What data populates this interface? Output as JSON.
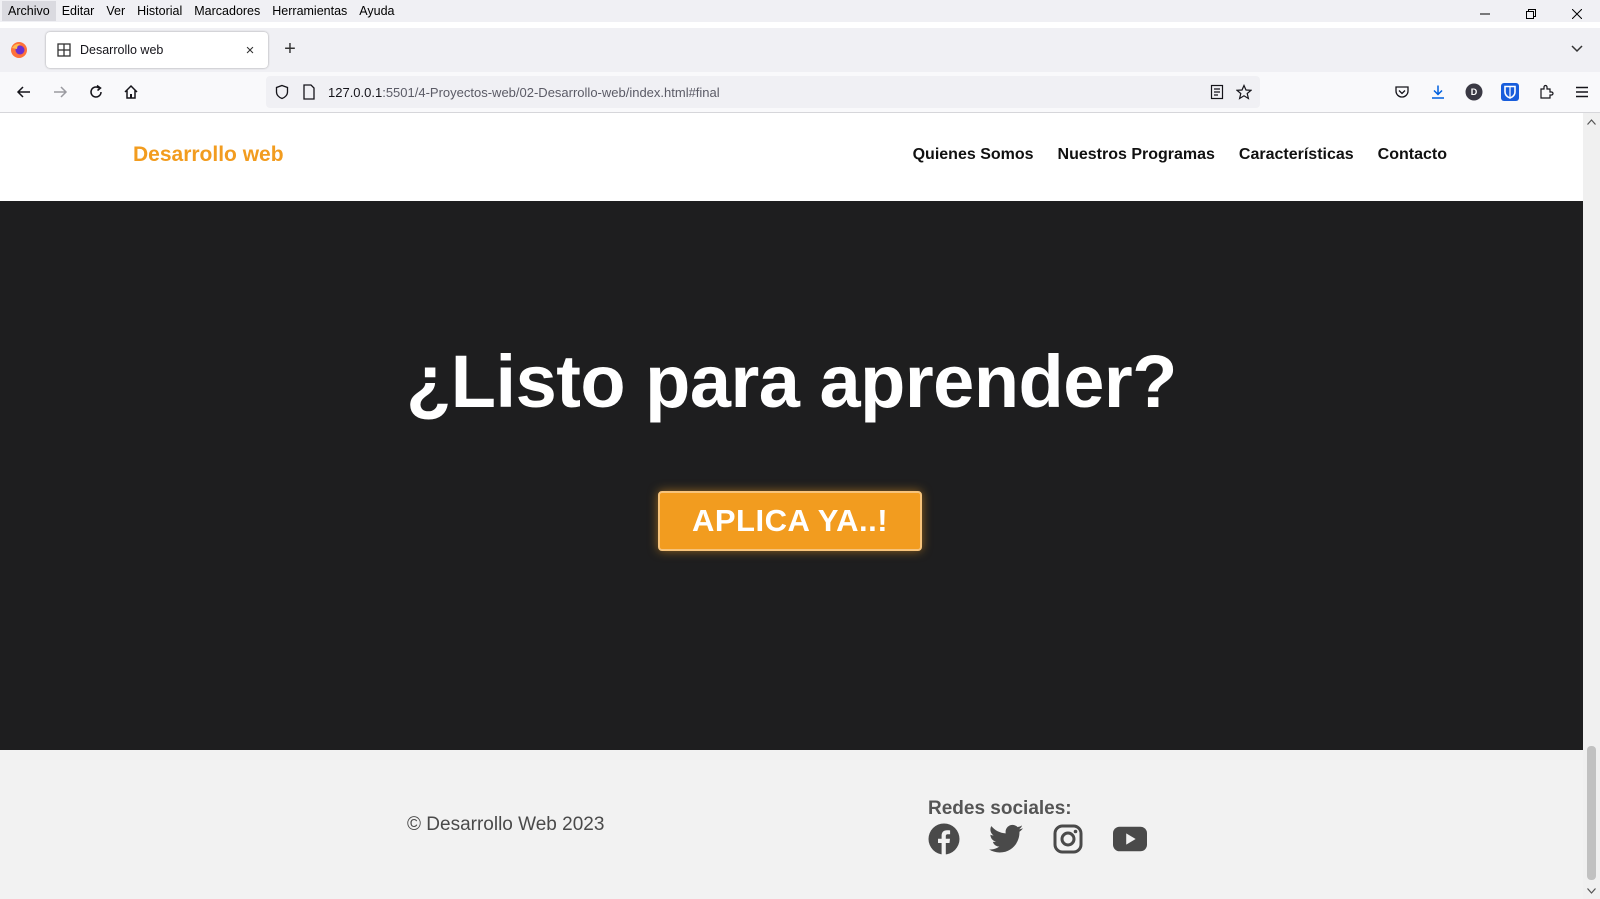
{
  "browser": {
    "menu": [
      {
        "label": "Archivo"
      },
      {
        "label": "Editar"
      },
      {
        "label": "Ver"
      },
      {
        "label": "Historial"
      },
      {
        "label": "Marcadores"
      },
      {
        "label": "Herramientas"
      },
      {
        "label": "Ayuda"
      }
    ],
    "tab": {
      "title": "Desarrollo web",
      "close": "×"
    },
    "new_tab": "+",
    "url": {
      "host": "127.0.0.1",
      "path": ":5501/4-Proyectos-web/02-Desarrollo-web/index.html#final"
    },
    "profile_initial": "D",
    "icons": [
      "back-icon",
      "forward-icon",
      "reload-icon",
      "home-icon",
      "shield-icon",
      "page-icon",
      "reader-mode-icon",
      "bookmark-star-icon",
      "pocket-icon",
      "download-icon",
      "account-icon",
      "bitwarden-icon",
      "extensions-icon",
      "menu-icon"
    ]
  },
  "site": {
    "brand": "Desarrollo web",
    "brand_color": "#f29c1f",
    "nav": [
      {
        "label": "Quienes Somos"
      },
      {
        "label": "Nuestros Programas"
      },
      {
        "label": "Características"
      },
      {
        "label": "Contacto"
      }
    ],
    "hero": {
      "title": "¿Listo para aprender?",
      "cta": "APLICA YA..!",
      "background": "#1e1e1f"
    },
    "footer": {
      "copyright": "© Desarrollo Web 2023",
      "social_title": "Redes sociales:",
      "social_icons": [
        "facebook-icon",
        "twitter-icon",
        "instagram-icon",
        "youtube-icon"
      ]
    }
  }
}
